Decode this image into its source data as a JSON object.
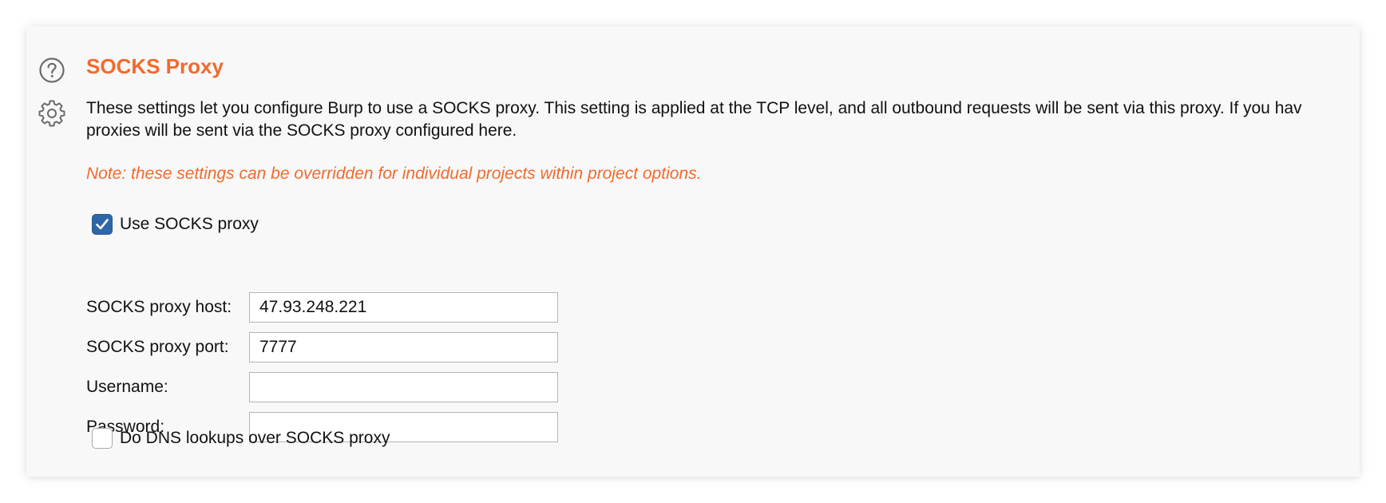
{
  "section": {
    "title": "SOCKS Proxy",
    "description_line1": "These settings let you configure Burp to use a SOCKS proxy. This setting is applied at the TCP level, and all outbound requests will be sent via this proxy. If you hav",
    "description_line2": "proxies will be sent via the SOCKS proxy configured here.",
    "note": "Note: these settings can be overridden for individual projects within project options."
  },
  "icons": {
    "help": "help-circle-icon",
    "settings": "gear-icon"
  },
  "use_socks": {
    "label": "Use SOCKS proxy",
    "checked": true
  },
  "fields": {
    "host": {
      "label": "SOCKS proxy host:",
      "value": "47.93.248.221"
    },
    "port": {
      "label": "SOCKS proxy port:",
      "value": "7777"
    },
    "username": {
      "label": "Username:",
      "value": ""
    },
    "password": {
      "label": "Password:",
      "value": ""
    }
  },
  "dns_over_socks": {
    "label": "Do DNS lookups over SOCKS proxy",
    "checked": false
  },
  "colors": {
    "accent": "#f26a2e",
    "checkbox_checked": "#2f66a8",
    "panel_bg": "#f8f8f8"
  }
}
